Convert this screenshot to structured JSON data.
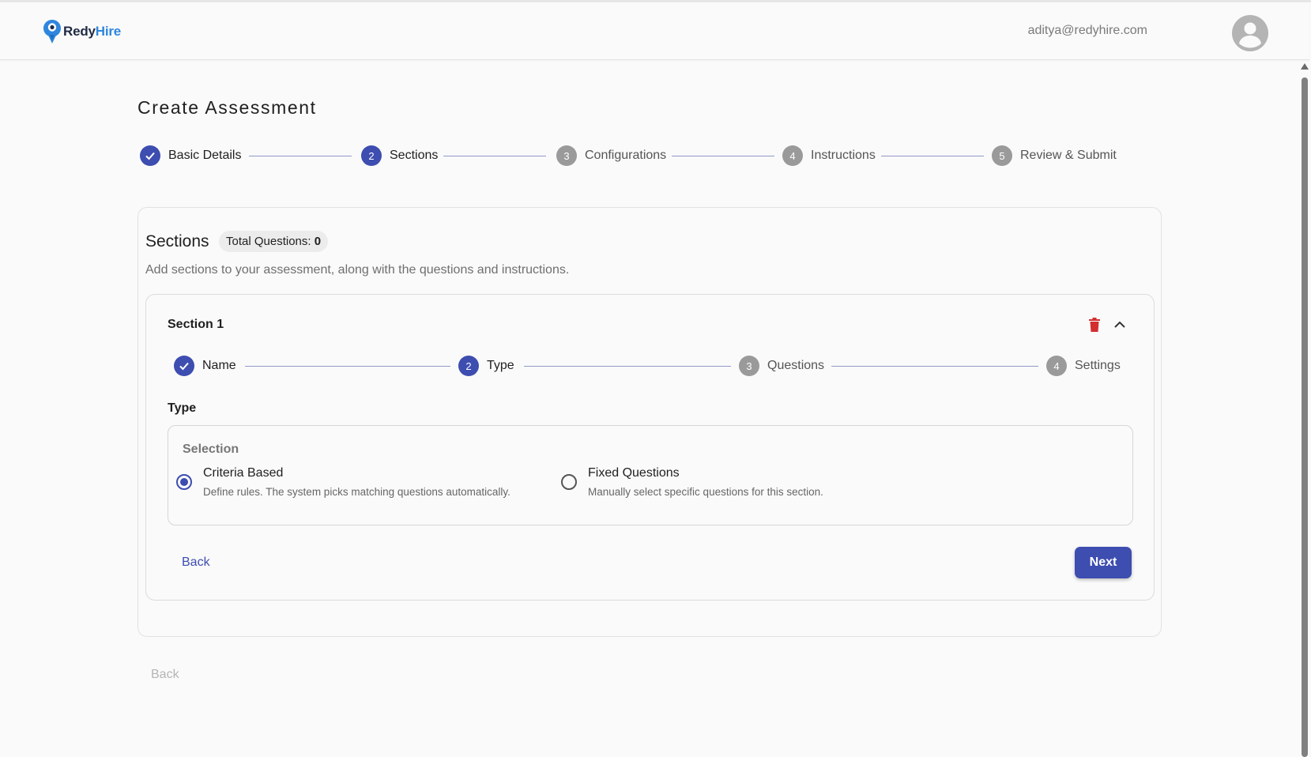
{
  "header": {
    "brand_part1": "Redy",
    "brand_part2": "Hire",
    "user_email": "aditya@redyhire.com"
  },
  "page": {
    "title": "Create Assessment"
  },
  "main_stepper": [
    {
      "label": "Basic Details",
      "number": "",
      "state": "completed"
    },
    {
      "label": "Sections",
      "number": "2",
      "state": "active"
    },
    {
      "label": "Configurations",
      "number": "3",
      "state": "pending"
    },
    {
      "label": "Instructions",
      "number": "4",
      "state": "pending"
    },
    {
      "label": "Review & Submit",
      "number": "5",
      "state": "pending"
    }
  ],
  "sections_card": {
    "title": "Sections",
    "total_label": "Total Questions:",
    "total_value": "0",
    "description": "Add sections to your assessment, along with the questions and instructions."
  },
  "section": {
    "name": "Section 1",
    "stepper": [
      {
        "label": "Name",
        "number": "",
        "state": "completed"
      },
      {
        "label": "Type",
        "number": "2",
        "state": "active"
      },
      {
        "label": "Questions",
        "number": "3",
        "state": "pending"
      },
      {
        "label": "Settings",
        "number": "4",
        "state": "pending"
      }
    ],
    "type_heading": "Type",
    "selection_legend": "Selection",
    "options": [
      {
        "title": "Criteria Based",
        "description": "Define rules. The system picks matching questions automatically.",
        "selected": true
      },
      {
        "title": "Fixed Questions",
        "description": "Manually select specific questions for this section.",
        "selected": false
      }
    ],
    "back_label": "Back",
    "next_label": "Next"
  },
  "footer": {
    "back_label": "Back"
  },
  "colors": {
    "primary": "#3d4db0",
    "brand_blue": "#2e86de",
    "delete_red": "#d32f2f",
    "pending_step": "#9a9a9a"
  },
  "icons": {
    "logo": "location-pin-logo-icon",
    "avatar": "user-avatar-icon",
    "completed_step": "checkmark-icon",
    "delete": "trash-icon",
    "collapse": "chevron-up-icon"
  }
}
